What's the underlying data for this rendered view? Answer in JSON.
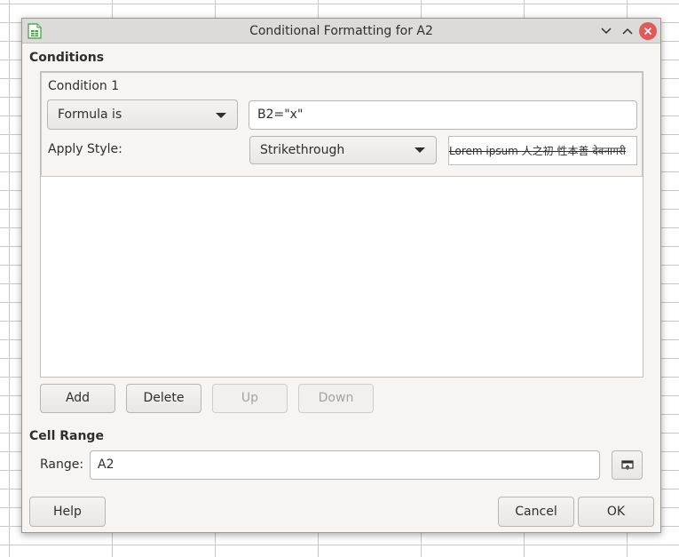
{
  "window": {
    "title": "Conditional Formatting for A2"
  },
  "conditions": {
    "heading": "Conditions",
    "condition": {
      "label": "Condition 1",
      "type_value": "Formula is",
      "formula_value": "B2=\"x\"",
      "apply_style_label": "Apply Style:",
      "style_value": "Strikethrough",
      "preview_text": "Lorem ipsum 人之初 性本善 देवनागरी"
    },
    "buttons": {
      "add": "Add",
      "delete": "Delete",
      "up": "Up",
      "down": "Down"
    }
  },
  "cell_range": {
    "heading": "Cell Range",
    "range_label": "Range:",
    "range_value": "A2"
  },
  "footer": {
    "help": "Help",
    "cancel": "Cancel",
    "ok": "OK"
  },
  "colors": {
    "close_button": "#e05a5a",
    "dialog_bg": "#f6f5f4",
    "titlebar_bg": "#dcdbda"
  }
}
